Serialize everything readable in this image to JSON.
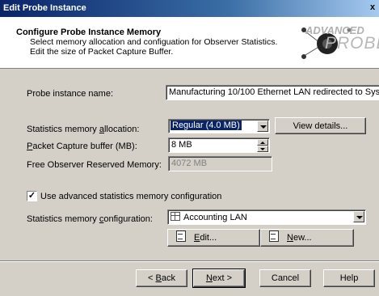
{
  "window": {
    "title": "Edit Probe Instance",
    "close_glyph": "x"
  },
  "header": {
    "title": "Configure Probe Instance Memory",
    "description": "Select memory allocation and configuation for Observer Statistics. Edit the size of Packet Capture Buffer.",
    "logo_line1": "ADVANCED",
    "logo_line2": "PROBE"
  },
  "form": {
    "probe_name_label": "Probe instance name:",
    "probe_name_value": "Manufacturing 10/100 Ethernet LAN redirected to Sys",
    "stats_alloc_label_pre": "Statistics memory ",
    "stats_alloc_label_u": "a",
    "stats_alloc_label_post": "llocation:",
    "stats_alloc_value": "Regular (4.0 MB)",
    "view_details_label": "View details...",
    "capture_label_u": "P",
    "capture_label_post": "acket Capture buffer (MB):",
    "capture_value": "8 MB",
    "free_mem_label": "Free Observer Reserved Memory:",
    "free_mem_value": "4072 MB",
    "advanced_checkbox_label": "Use advanced statistics memory configuration",
    "advanced_checked": true,
    "stats_config_label_pre": "Statistics memory ",
    "stats_config_label_u": "c",
    "stats_config_label_post": "onfiguration:",
    "stats_config_value": "Accounting LAN",
    "edit_label_u": "E",
    "edit_label_post": "dit...",
    "new_label_u": "N",
    "new_label_post": "ew..."
  },
  "footer": {
    "back_pre": "< ",
    "back_u": "B",
    "back_post": "ack",
    "next_u": "N",
    "next_post": "ext >",
    "cancel": "Cancel",
    "help": "Help"
  },
  "icons": {
    "close": "close-icon",
    "dropdown": "chevron-down-icon",
    "spinner": "spinner-icon",
    "grid": "table-icon",
    "edit": "edit-document-icon",
    "new": "new-document-icon"
  }
}
